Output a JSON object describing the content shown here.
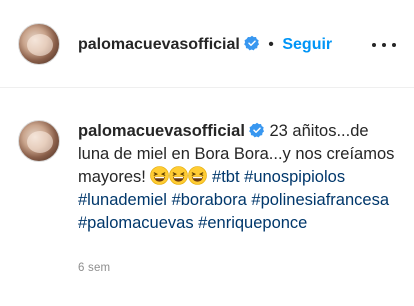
{
  "header": {
    "username": "palomacuevasofficial",
    "separator": "•",
    "follow_label": "Seguir",
    "verified_icon": "verified-badge-icon",
    "more_icon": "more-options-icon"
  },
  "post": {
    "username": "palomacuevasofficial",
    "caption_text": "23 añitos...de luna de miel en Bora Bora...y nos creíamos mayores! ",
    "emojis": [
      "grinning-squinting-face",
      "grinning-squinting-face",
      "grinning-squinting-face"
    ],
    "hashtags": [
      "#tbt",
      "#unospipiolos",
      "#lunademiel",
      "#borabora",
      "#polinesiafrancesa",
      "#palomacuevas",
      "#enriqueponce"
    ],
    "timestamp": "6 sem"
  },
  "colors": {
    "link_blue": "#0095f6",
    "hashtag": "#00376b",
    "verified": "#3897f0",
    "muted": "#8e8e8e"
  }
}
